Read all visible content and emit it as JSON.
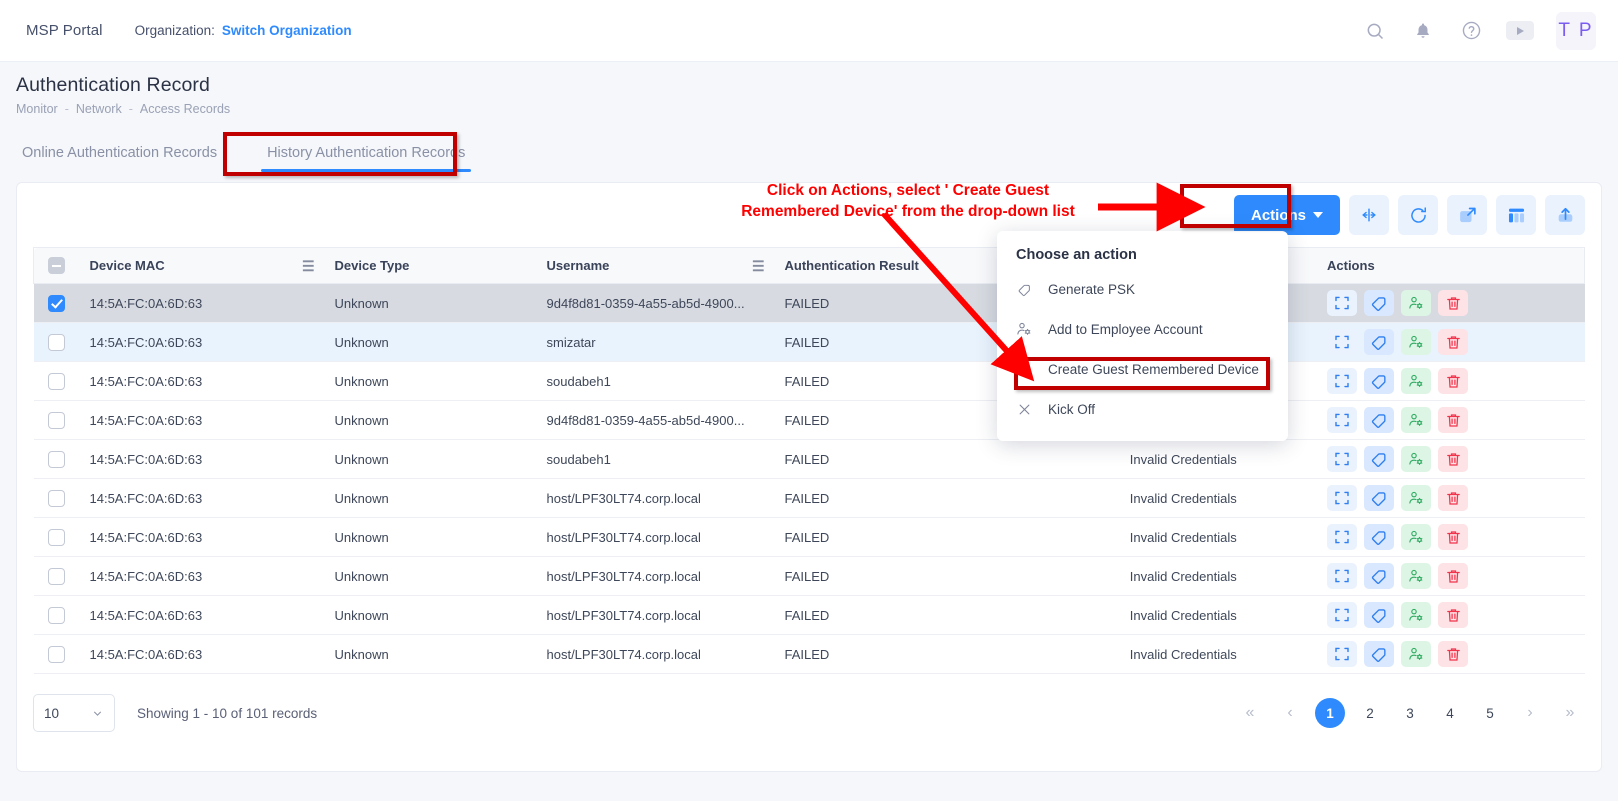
{
  "topbar": {
    "brand": "MSP Portal",
    "org_label": "Organization:",
    "org_link": "Switch Organization",
    "avatar_initials": "T P",
    "icons": [
      "search-icon",
      "bell-icon",
      "help-icon",
      "video-icon"
    ]
  },
  "page": {
    "title": "Authentication Record",
    "breadcrumb": [
      "Monitor",
      "Network",
      "Access Records"
    ],
    "breadcrumb_sep": "-"
  },
  "tabs": [
    {
      "label": "Online Authentication Records",
      "active": false
    },
    {
      "label": "History Authentication Records",
      "active": true
    }
  ],
  "toolbar": {
    "actions_label": "Actions",
    "icons": [
      "fit-columns-icon",
      "refresh-icon",
      "fullscreen-icon",
      "column-settings-icon",
      "upload-icon"
    ]
  },
  "dropdown": {
    "title": "Choose an action",
    "items": [
      {
        "label": "Generate PSK",
        "icon": "tag-icon",
        "highlighted": false
      },
      {
        "label": "Add to Employee Account",
        "icon": "user-settings-icon",
        "highlighted": false
      },
      {
        "label": "Create Guest Remembered Device",
        "icon": "tag-icon",
        "highlighted": true
      },
      {
        "label": "Kick Off",
        "icon": "close-icon",
        "highlighted": false
      }
    ]
  },
  "table": {
    "columns": [
      {
        "label": "Device MAC",
        "menu": true
      },
      {
        "label": "Device Type",
        "menu": false
      },
      {
        "label": "Username",
        "menu": true
      },
      {
        "label": "Authentication Result",
        "menu": false
      },
      {
        "label": "",
        "menu": false
      },
      {
        "label": "Actions",
        "menu": false
      }
    ],
    "header_checkbox_state": "indeterminate",
    "rows": [
      {
        "checked": true,
        "state": "selected",
        "mac": "14:5A:FC:0A:6D:63",
        "type": "Unknown",
        "username": "9d4f8d81-0359-4a55-ab5d-4900...",
        "result": "FAILED",
        "reason": ""
      },
      {
        "checked": false,
        "state": "hovered",
        "mac": "14:5A:FC:0A:6D:63",
        "type": "Unknown",
        "username": "smizatar",
        "result": "FAILED",
        "reason": ""
      },
      {
        "checked": false,
        "state": "",
        "mac": "14:5A:FC:0A:6D:63",
        "type": "Unknown",
        "username": "soudabeh1",
        "result": "FAILED",
        "reason": ""
      },
      {
        "checked": false,
        "state": "",
        "mac": "14:5A:FC:0A:6D:63",
        "type": "Unknown",
        "username": "9d4f8d81-0359-4a55-ab5d-4900...",
        "result": "FAILED",
        "reason": ""
      },
      {
        "checked": false,
        "state": "",
        "mac": "14:5A:FC:0A:6D:63",
        "type": "Unknown",
        "username": "soudabeh1",
        "result": "FAILED",
        "reason": "Invalid Credentials"
      },
      {
        "checked": false,
        "state": "",
        "mac": "14:5A:FC:0A:6D:63",
        "type": "Unknown",
        "username": "host/LPF30LT74.corp.local",
        "result": "FAILED",
        "reason": "Invalid Credentials"
      },
      {
        "checked": false,
        "state": "",
        "mac": "14:5A:FC:0A:6D:63",
        "type": "Unknown",
        "username": "host/LPF30LT74.corp.local",
        "result": "FAILED",
        "reason": "Invalid Credentials"
      },
      {
        "checked": false,
        "state": "",
        "mac": "14:5A:FC:0A:6D:63",
        "type": "Unknown",
        "username": "host/LPF30LT74.corp.local",
        "result": "FAILED",
        "reason": "Invalid Credentials"
      },
      {
        "checked": false,
        "state": "",
        "mac": "14:5A:FC:0A:6D:63",
        "type": "Unknown",
        "username": "host/LPF30LT74.corp.local",
        "result": "FAILED",
        "reason": "Invalid Credentials"
      },
      {
        "checked": false,
        "state": "",
        "mac": "14:5A:FC:0A:6D:63",
        "type": "Unknown",
        "username": "host/LPF30LT74.corp.local",
        "result": "FAILED",
        "reason": "Invalid Credentials"
      }
    ],
    "row_action_icons": [
      "expand-icon",
      "tag-icon",
      "user-settings-icon",
      "delete-icon"
    ]
  },
  "footer": {
    "page_size": "10",
    "showing": "Showing 1 - 10 of 101 records",
    "pages": [
      "1",
      "2",
      "3",
      "4",
      "5"
    ],
    "active_page": "1",
    "nav": {
      "first": "«",
      "prev": "‹",
      "next": "›",
      "last": "»"
    }
  },
  "annotation": {
    "text_line1": "Click on Actions, select ' Create Guest",
    "text_line2": "Remembered Device' from the drop-down list",
    "color": "#fe0000",
    "box_color": "#c00000"
  }
}
